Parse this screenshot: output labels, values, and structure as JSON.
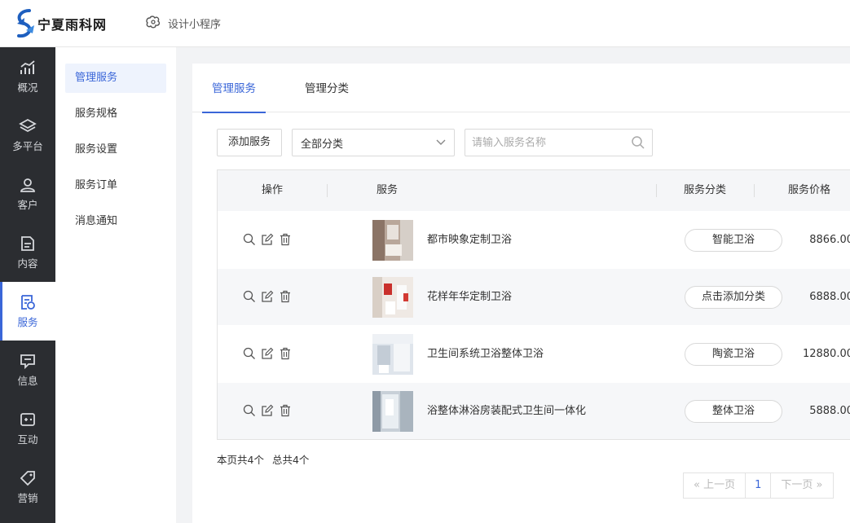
{
  "header": {
    "logo_text": "宁夏雨科网",
    "mini_program_label": "设计小程序"
  },
  "rail": [
    {
      "label": "概况",
      "icon": "chart-icon"
    },
    {
      "label": "多平台",
      "icon": "layers-icon"
    },
    {
      "label": "客户",
      "icon": "user-icon"
    },
    {
      "label": "内容",
      "icon": "document-icon"
    },
    {
      "label": "服务",
      "icon": "service-icon"
    },
    {
      "label": "信息",
      "icon": "message-icon"
    },
    {
      "label": "互动",
      "icon": "interact-icon"
    },
    {
      "label": "营销",
      "icon": "tag-icon"
    }
  ],
  "submenu": [
    "管理服务",
    "服务规格",
    "服务设置",
    "服务订单",
    "消息通知"
  ],
  "tabs": [
    "管理服务",
    "管理分类"
  ],
  "toolbar": {
    "add_label": "添加服务",
    "category_value": "全部分类",
    "search_placeholder": "请输入服务名称"
  },
  "table": {
    "headers": {
      "ops": "操作",
      "service": "服务",
      "category": "服务分类",
      "price": "服务价格"
    },
    "rows": [
      {
        "name": "都市映象定制卫浴",
        "category": "智能卫浴",
        "price": "8866.00"
      },
      {
        "name": "花样年华定制卫浴",
        "category": "点击添加分类",
        "price": "6888.00"
      },
      {
        "name": "卫生间系统卫浴整体卫浴",
        "category": "陶瓷卫浴",
        "price": "12880.00"
      },
      {
        "name": "浴整体淋浴房装配式卫生间一体化",
        "category": "整体卫浴",
        "price": "5888.00"
      }
    ]
  },
  "summary": {
    "page_count": "本页共4个",
    "total_count": "总共4个"
  },
  "pager": {
    "prev": "上一页",
    "page": "1",
    "next": "下一页"
  },
  "colors": {
    "accent": "#3a66d8",
    "rail_bg": "#2b2d31"
  }
}
